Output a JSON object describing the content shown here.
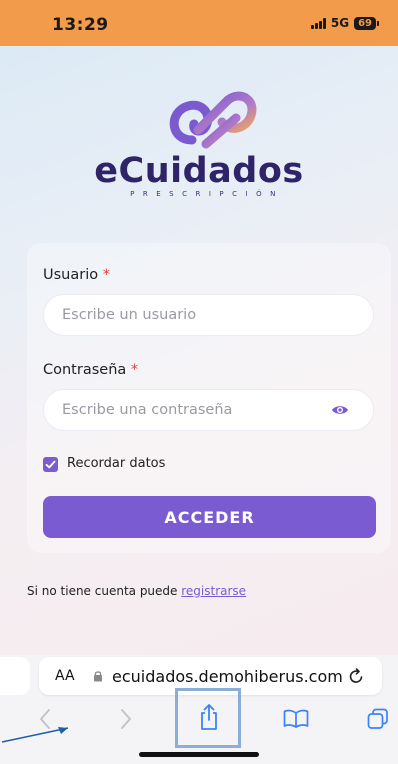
{
  "status_bar": {
    "time": "13:29",
    "network": "5G",
    "battery": "69"
  },
  "app": {
    "name": "eCuidados",
    "subtitle": "PRESCRIPCIÓN"
  },
  "colors": {
    "accent": "#7a5bd2",
    "status_bar": "#f29b4b",
    "required": "#e0413f"
  },
  "login": {
    "username_label": "Usuario",
    "username_placeholder": "Escribe un usuario",
    "password_label": "Contraseña",
    "password_placeholder": "Escribe una contraseña",
    "required_mark": "*",
    "remember_label": "Recordar datos",
    "remember_checked": true,
    "submit_label": "ACCEDER"
  },
  "register": {
    "prefix": "Si no tiene cuenta puede",
    "link": "registrarse"
  },
  "browser": {
    "text_size_label": "AA",
    "url": "ecuidados.demohiberus.com",
    "toolbar_icons": [
      "back-icon",
      "forward-icon",
      "share-icon",
      "bookmarks-icon",
      "tabs-icon"
    ]
  }
}
